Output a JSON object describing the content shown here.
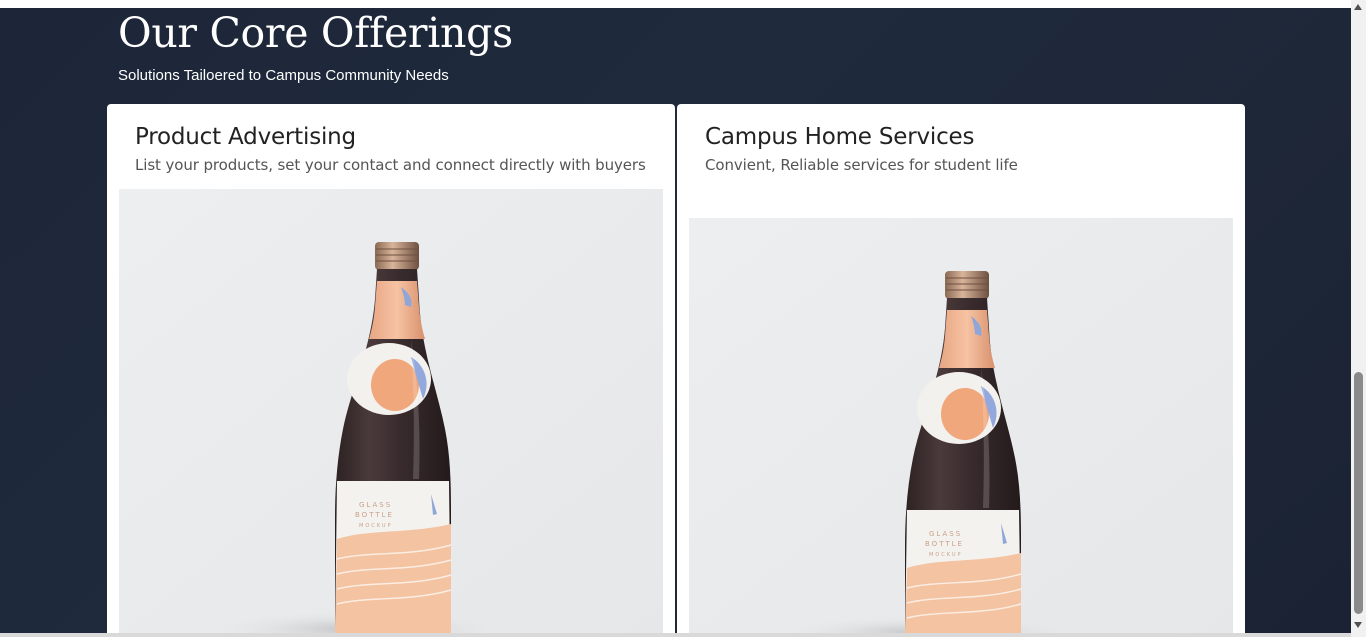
{
  "section": {
    "title": "Our Core Offerings",
    "subtitle": "Solutions Tailoered to Campus Community Needs"
  },
  "offerings": [
    {
      "title": "Product Advertising",
      "description": "List your products, set your contact and connect directly with buyers",
      "image": "glass-bottle-product-photo"
    },
    {
      "title": "Campus Home Services",
      "description": "Convient, Reliable services for student life",
      "image": "glass-bottle-product-photo"
    }
  ],
  "bottle_label": {
    "line1": "GLASS",
    "line2": "BOTTLE",
    "line3": "MOCKUP"
  },
  "colors": {
    "background": "#1e2738",
    "card": "#ffffff",
    "image_bg": "#ebecee",
    "bottle_glass": "#3a2c2e",
    "bottle_accent": "#f0b28e"
  }
}
